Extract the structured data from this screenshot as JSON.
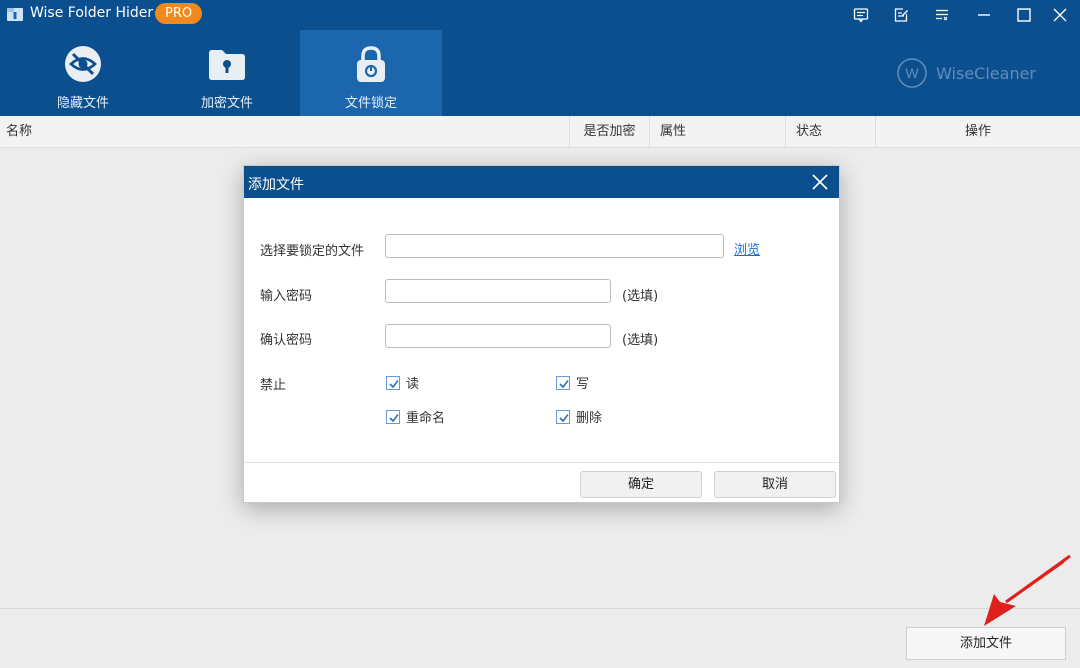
{
  "app": {
    "title": "Wise Folder Hider",
    "badge": "PRO",
    "brand": "WiseCleaner",
    "brand_mark": "W"
  },
  "titlebar_buttons": [
    {
      "name": "feedback-icon"
    },
    {
      "name": "edit-icon"
    },
    {
      "name": "menu-icon"
    },
    {
      "name": "minimize-icon"
    },
    {
      "name": "maximize-icon"
    },
    {
      "name": "close-icon"
    }
  ],
  "nav": {
    "tabs": [
      {
        "label": "隐藏文件",
        "icon": "hidden-eye-icon",
        "active": false
      },
      {
        "label": "加密文件",
        "icon": "encrypted-folder-icon",
        "active": false
      },
      {
        "label": "文件锁定",
        "icon": "padlock-icon",
        "active": true
      }
    ]
  },
  "table": {
    "columns": [
      "名称",
      "是否加密",
      "属性",
      "状态",
      "操作"
    ]
  },
  "footer": {
    "add_file_label": "添加文件"
  },
  "dialog": {
    "title": "添加文件",
    "file_label": "选择要锁定的文件",
    "file_value": "",
    "browse_label": "浏览",
    "password_label": "输入密码",
    "password_value": "",
    "password_hint": "(选填)",
    "confirm_label": "确认密码",
    "confirm_value": "",
    "confirm_hint": "(选填)",
    "forbid_label": "禁止",
    "options": [
      {
        "label": "读",
        "checked": true
      },
      {
        "label": "写",
        "checked": true
      },
      {
        "label": "重命名",
        "checked": true
      },
      {
        "label": "删除",
        "checked": true
      }
    ],
    "ok_label": "确定",
    "cancel_label": "取消"
  },
  "colors": {
    "header_blue": "#0c4f8f",
    "active_tab": "#1b66ad",
    "badge_orange": "#f08a1c",
    "link_blue": "#1a6fd1",
    "arrow_red": "#e0201b"
  }
}
